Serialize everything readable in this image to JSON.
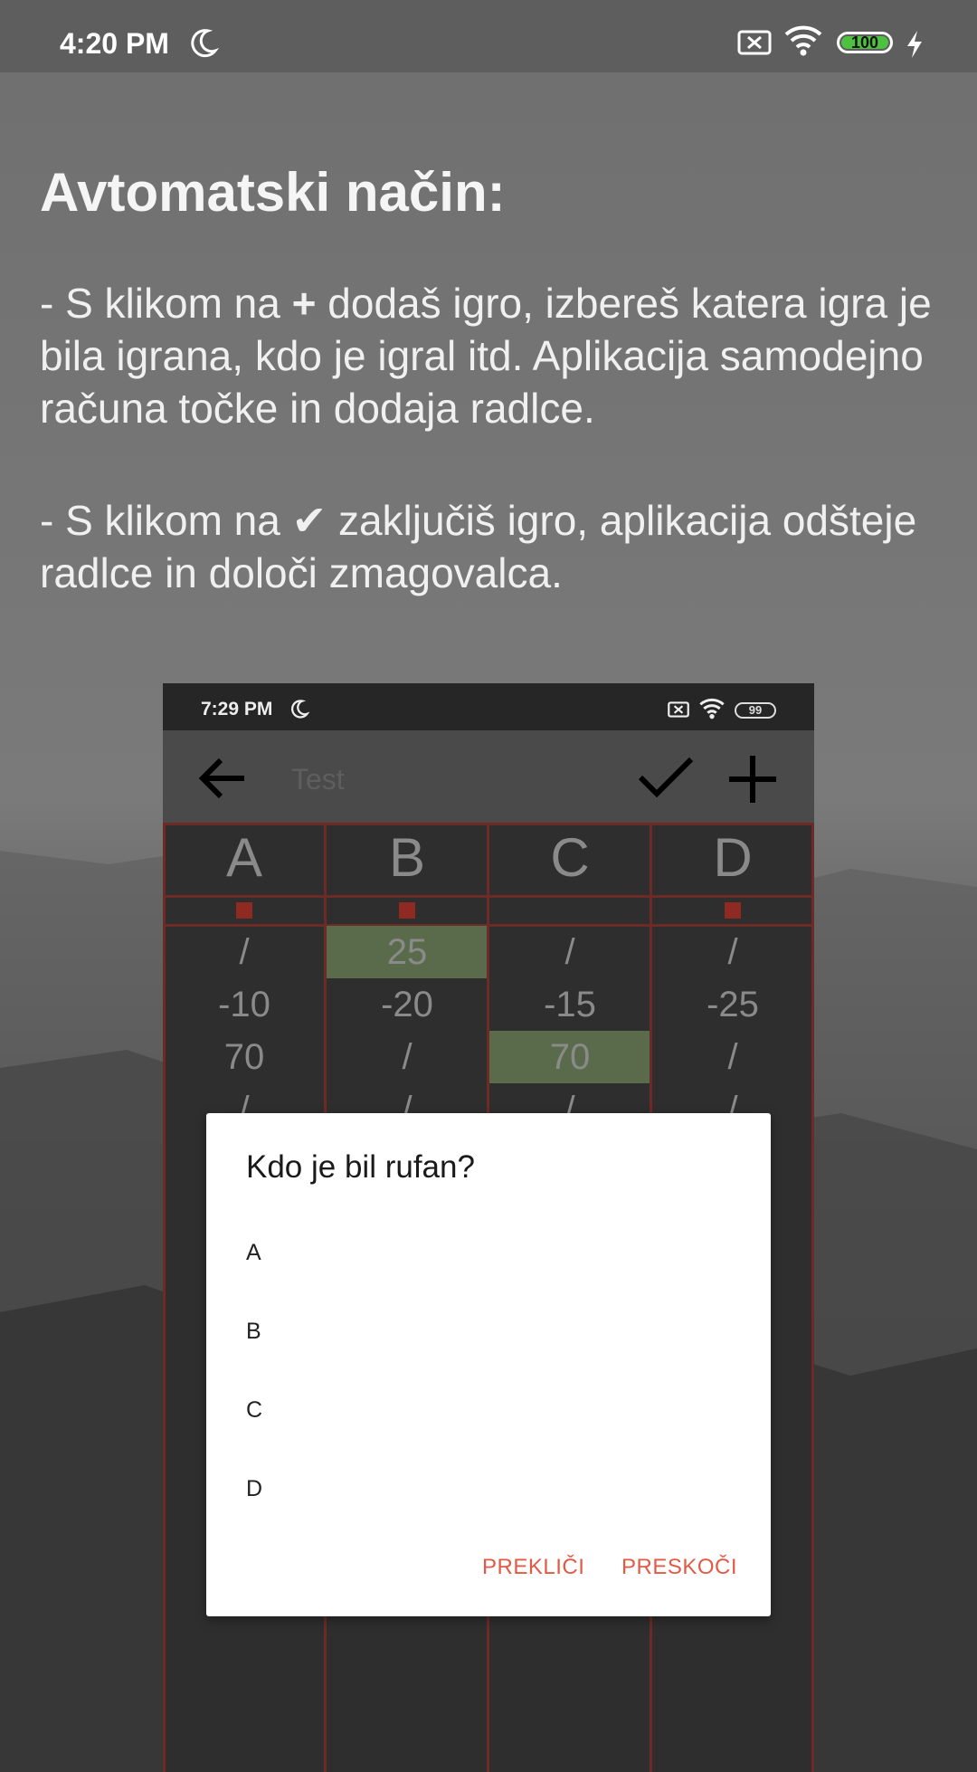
{
  "status_bar": {
    "time": "4:20 PM",
    "battery": "100"
  },
  "heading": "Avtomatski način:",
  "para1": {
    "a": "- S klikom na ",
    "symbol": "+",
    "b": " dodaš igro, izbereš katera igra je bila igrana, kdo je igral itd. Aplikacija samodejno računa točke in dodaja radlce."
  },
  "para2": {
    "a": "- S klikom na ",
    "symbol": "✔",
    "b": " zaključiš igro, aplikacija odšteje radlce in določi zmagovalca."
  },
  "phone": {
    "status_time": "7:29 PM",
    "battery": "99",
    "title": "Test",
    "columns": [
      {
        "name": "A",
        "marked": true,
        "cells": [
          "/",
          "-10",
          "70",
          "/"
        ]
      },
      {
        "name": "B",
        "marked": true,
        "cells": [
          "25",
          "-20",
          "/",
          "/"
        ]
      },
      {
        "name": "C",
        "marked": false,
        "cells": [
          "/",
          "-15",
          "70",
          "/"
        ]
      },
      {
        "name": "D",
        "marked": true,
        "cells": [
          "/",
          "-25",
          "/",
          "/"
        ]
      }
    ],
    "highlighted": [
      [
        1,
        0
      ],
      [
        2,
        2
      ]
    ]
  },
  "dialog": {
    "title": "Kdo je bil rufan?",
    "options": [
      "A",
      "B",
      "C",
      "D"
    ],
    "cancel": "PREKLIČI",
    "skip": "PRESKOČI"
  },
  "colors": {
    "accent": "#e15a45",
    "win_cell": "#5a6b4b",
    "grid_line": "#6e2a24",
    "marker": "#8f2a22"
  },
  "icons": [
    "moon-icon",
    "sim-icon",
    "wifi-icon",
    "battery-icon",
    "charging-icon",
    "back-arrow-icon",
    "check-icon",
    "plus-icon"
  ]
}
